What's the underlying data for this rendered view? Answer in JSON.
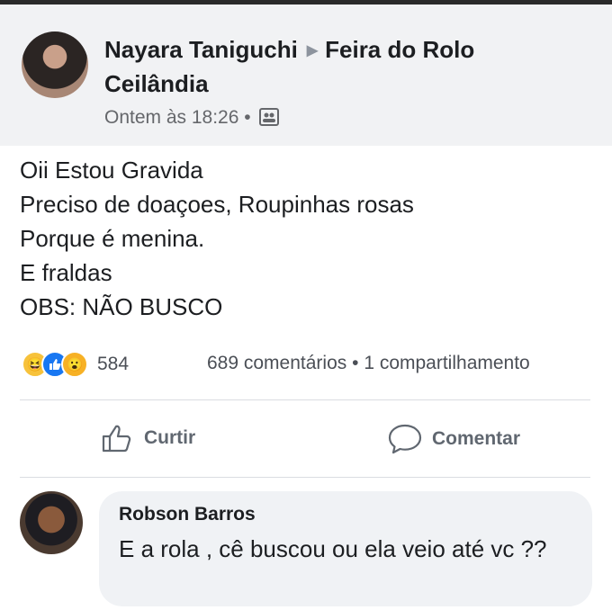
{
  "post": {
    "author": "Nayara Taniguchi",
    "group_line1": "Feira do Rolo",
    "group_line2": "Ceilândia",
    "timestamp": "Ontem às 18:26",
    "lines": [
      "Oii Estou Gravida",
      "Preciso de doaçoes, Roupinhas rosas",
      "Porque é  menina.",
      "E fraldas",
      "OBS: NÃO BUSCO"
    ]
  },
  "engagement": {
    "reaction_icons": [
      "haha-icon",
      "like-icon",
      "wow-icon"
    ],
    "reaction_count": "584",
    "comments": "689 comentários",
    "separator": "•",
    "shares": "1 compartilhamento"
  },
  "actions": {
    "like_label": "Curtir",
    "comment_label": "Comentar"
  },
  "comment": {
    "author": "Robson Barros",
    "text": "E a rola , cê buscou ou ela veio até vc ??"
  },
  "colors": {
    "header_bg": "#f1f2f4",
    "like_blue": "#1877f2",
    "muted_text": "#65676b",
    "bubble_bg": "#f0f2f5"
  }
}
